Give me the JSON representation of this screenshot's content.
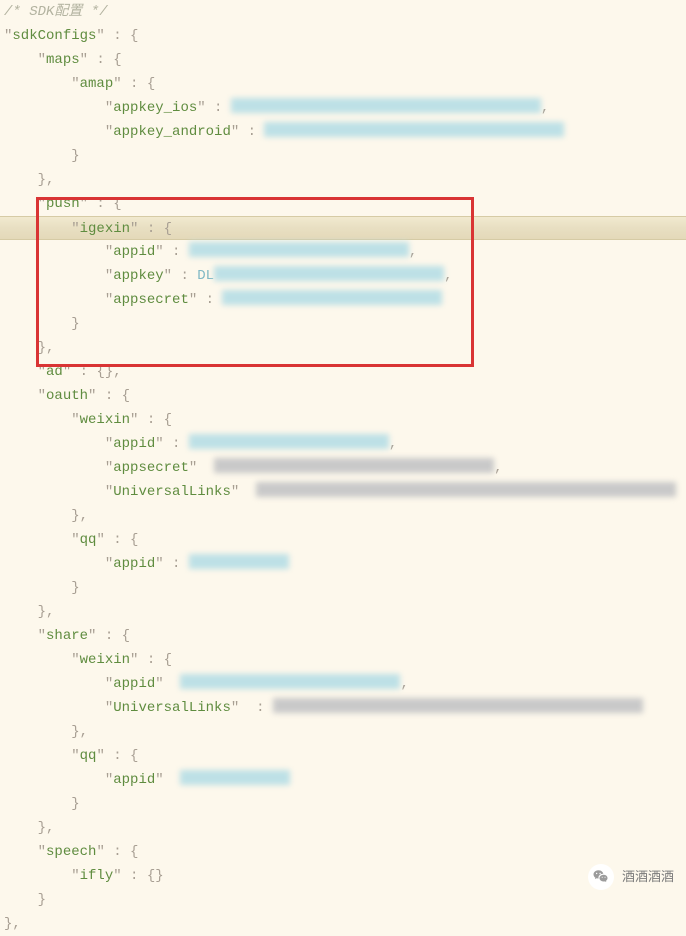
{
  "comment_line": "/* SDK配置 */",
  "lines": [
    {
      "indent": 0,
      "key": "sdkConfigs",
      "after": " : {"
    },
    {
      "indent": 1,
      "key": "maps",
      "after": " : {"
    },
    {
      "indent": 2,
      "key": "amap",
      "after": " : {"
    },
    {
      "indent": 3,
      "key": "appkey_ios",
      "after": " : ",
      "redact_w": 310,
      "comma": true
    },
    {
      "indent": 3,
      "key": "appkey_android",
      "after": " : ",
      "redact_w": 300
    },
    {
      "indent": 2,
      "close": "}"
    },
    {
      "indent": 1,
      "close": "},"
    },
    {
      "indent": 1,
      "key": "push",
      "after": " : {"
    },
    {
      "indent": 2,
      "key": "igexin",
      "after": " : {",
      "highlighted": true
    },
    {
      "indent": 3,
      "key": "appid",
      "after": " : ",
      "redact_w": 220,
      "comma": true
    },
    {
      "indent": 3,
      "key": "appkey",
      "after": " : ",
      "redact_w": 230,
      "comma": true,
      "redact_prefix": "DL"
    },
    {
      "indent": 3,
      "key": "appsecret",
      "after": " : ",
      "redact_w": 220
    },
    {
      "indent": 2,
      "close": "}"
    },
    {
      "indent": 1,
      "close": "},"
    },
    {
      "indent": 1,
      "key": "ad",
      "after": " : {},"
    },
    {
      "indent": 1,
      "key": "oauth",
      "after": " : {"
    },
    {
      "indent": 2,
      "key": "weixin",
      "after": " : {"
    },
    {
      "indent": 3,
      "key": "appid",
      "after": " : ",
      "redact_w": 200,
      "comma": true
    },
    {
      "indent": 3,
      "key": "appsecret",
      "after": "  ",
      "redact_w": 280,
      "comma": true,
      "gray": true
    },
    {
      "indent": 3,
      "key": "UniversalLinks",
      "after": "  ",
      "redact_w": 420,
      "gray": true
    },
    {
      "indent": 2,
      "close": "},"
    },
    {
      "indent": 2,
      "key": "qq",
      "after": " : {"
    },
    {
      "indent": 3,
      "key": "appid",
      "after": " : ",
      "redact_w": 100
    },
    {
      "indent": 2,
      "close": "}"
    },
    {
      "indent": 1,
      "close": "},"
    },
    {
      "indent": 1,
      "key": "share",
      "after": " : {"
    },
    {
      "indent": 2,
      "key": "weixin",
      "after": " : {"
    },
    {
      "indent": 3,
      "key": "appid",
      "after": "  ",
      "redact_w": 220,
      "comma": true
    },
    {
      "indent": 3,
      "key": "UniversalLinks",
      "after": "  : ",
      "redact_w": 370,
      "gray": true
    },
    {
      "indent": 2,
      "close": "},"
    },
    {
      "indent": 2,
      "key": "qq",
      "after": " : {"
    },
    {
      "indent": 3,
      "key": "appid",
      "after": "  ",
      "redact_w": 110
    },
    {
      "indent": 2,
      "close": "}"
    },
    {
      "indent": 1,
      "close": "},"
    },
    {
      "indent": 1,
      "key": "speech",
      "after": " : {"
    },
    {
      "indent": 2,
      "key": "ifly",
      "after": " : {}"
    },
    {
      "indent": 1,
      "close": "}"
    },
    {
      "indent": 0,
      "close": "},"
    }
  ],
  "watermark_text": "酒酒酒酒"
}
